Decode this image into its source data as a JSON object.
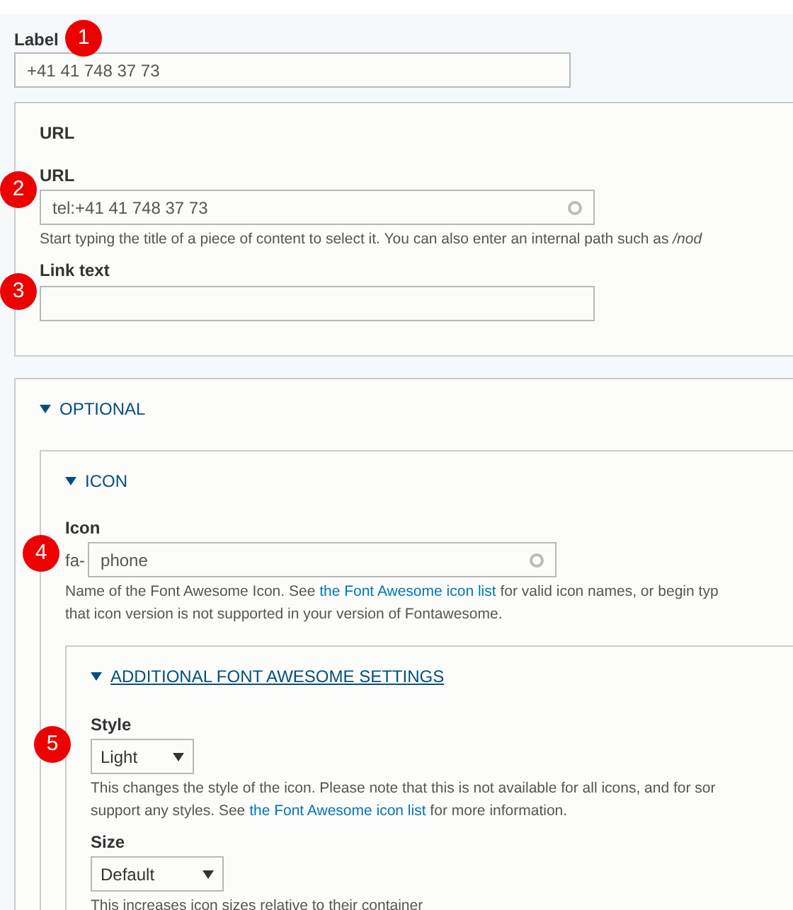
{
  "label_field": {
    "label": "Label",
    "marker": "1",
    "value": "+41 41 748 37 73"
  },
  "url_panel": {
    "title": "URL",
    "url_field": {
      "label": "URL",
      "marker": "2",
      "value": "tel:+41 41 748 37 73",
      "description": [
        [
          {
            "kind": "text",
            "text": "Start typing the title of a piece of content to select it. You can also enter an internal path such as "
          },
          {
            "kind": "italic",
            "text": "/nod"
          }
        ]
      ]
    },
    "link_text_field": {
      "label": "Link text",
      "marker": "3"
    }
  },
  "optional_panel": {
    "title": "OPTIONAL",
    "expanded": true,
    "icon_panel": {
      "title": "ICON",
      "expanded": true,
      "icon_field": {
        "label": "Icon",
        "marker": "4",
        "prefix": "fa-",
        "value": "phone",
        "description": [
          [
            {
              "kind": "text",
              "text": "Name of the Font Awesome Icon. See "
            },
            {
              "kind": "link",
              "text": "the Font Awesome icon list"
            },
            {
              "kind": "text",
              "text": " for valid icon names, or begin typ"
            }
          ],
          [
            {
              "kind": "text",
              "text": "that icon version is not supported in your version of Fontawesome."
            }
          ]
        ]
      },
      "settings_panel": {
        "title": "ADDITIONAL FONT AWESOME SETTINGS",
        "expanded": true,
        "fields": [
          {
            "label": "Style",
            "marker": "5",
            "value": "Light",
            "description": [
              [
                {
                  "kind": "text",
                  "text": "This changes the style of the icon. Please note that this is not available for all icons, and for sor"
                }
              ],
              [
                {
                  "kind": "text",
                  "text": "support any styles. See "
                },
                {
                  "kind": "link",
                  "text": "the Font Awesome icon list"
                },
                {
                  "kind": "text",
                  "text": " for more information."
                }
              ]
            ]
          },
          {
            "label": "Size",
            "value": "Default",
            "description": [
              [
                {
                  "kind": "text",
                  "text": "This increases icon sizes relative to their container"
                }
              ]
            ]
          }
        ]
      }
    }
  }
}
